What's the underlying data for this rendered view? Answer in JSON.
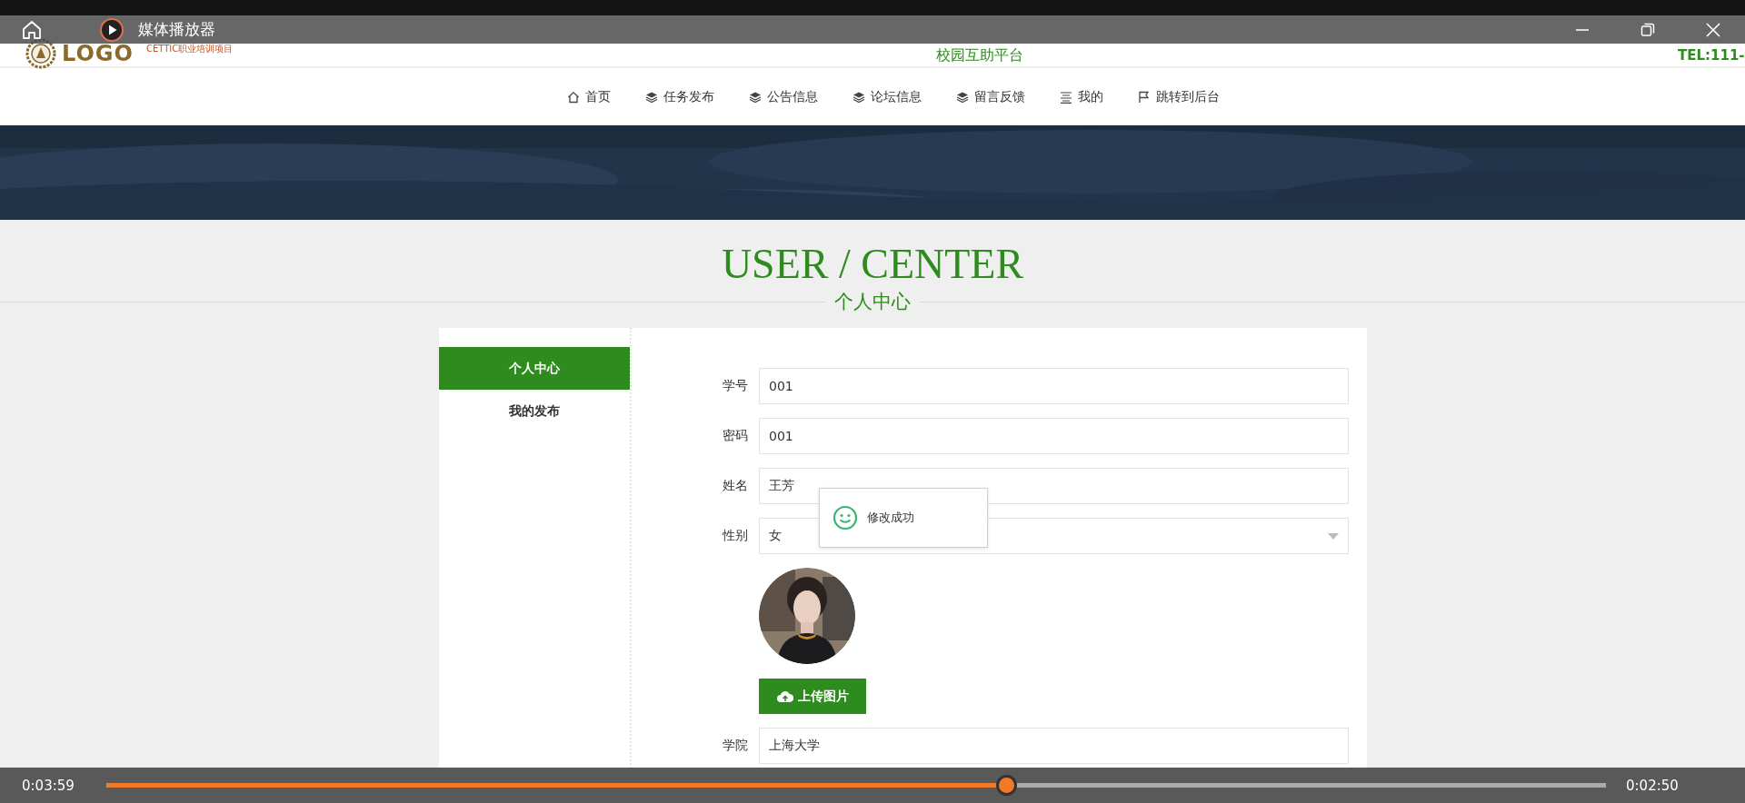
{
  "player": {
    "title": "媒体播放器",
    "elapsed": "0:03:59",
    "remaining": "0:02:50",
    "progress": {
      "level": 0.6
    }
  },
  "header": {
    "logo": "LOGO",
    "tagline": "CETTIC职业培训项目",
    "site_title": "校园互助平台",
    "phone": "TEL:111-"
  },
  "nav": [
    {
      "label": "首页",
      "kind": "home"
    },
    {
      "label": "任务发布",
      "kind": "layers"
    },
    {
      "label": "公告信息",
      "kind": "layers"
    },
    {
      "label": "论坛信息",
      "kind": "layers"
    },
    {
      "label": "留言反馈",
      "kind": "layers"
    },
    {
      "label": "我的",
      "kind": "list"
    },
    {
      "label": "跳转到后台",
      "kind": "flag"
    }
  ],
  "section_title": {
    "title": "USER / CENTER",
    "subtitle": "个人中心"
  },
  "sidebar": [
    {
      "label": "个人中心",
      "selected": true
    },
    {
      "label": "我的发布",
      "selected": false
    }
  ],
  "form": [
    {
      "kind": "text",
      "label": "学号",
      "value": "001"
    },
    {
      "kind": "text",
      "label": "密码",
      "value": "001"
    },
    {
      "kind": "text",
      "label": "姓名",
      "value": "王芳"
    },
    {
      "kind": "select",
      "label": "性别",
      "value": "女"
    },
    {
      "kind": "avatar",
      "button": "上传图片"
    },
    {
      "kind": "text",
      "label": "学院",
      "value": "上海大学"
    }
  ],
  "toast": {
    "message": "修改成功"
  }
}
